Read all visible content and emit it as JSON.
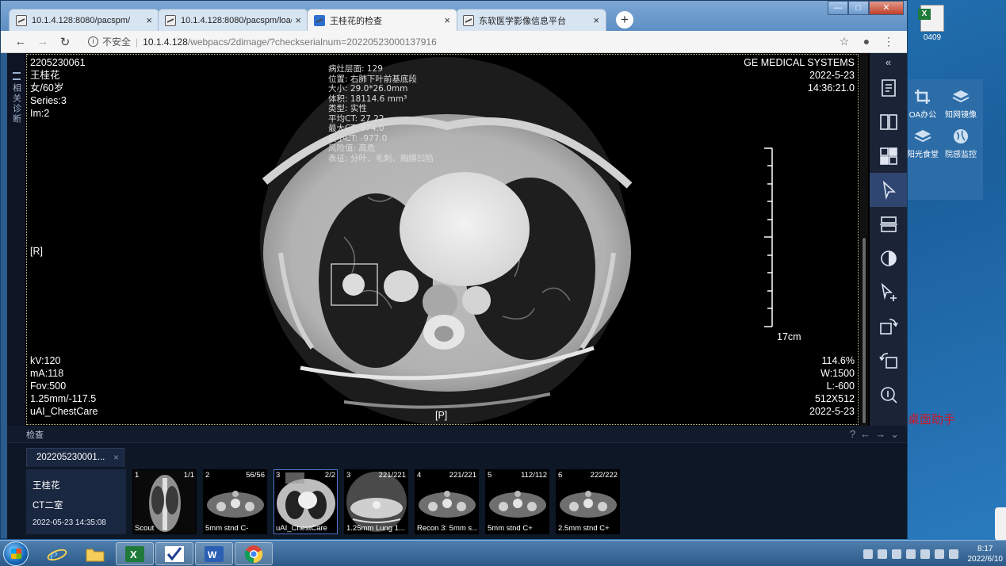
{
  "desktop": {
    "file_label": "0409",
    "icons": [
      {
        "label": "OA办公"
      },
      {
        "label": "知网镜像"
      },
      {
        "label": "阳光食堂"
      },
      {
        "label": "院感监控"
      }
    ],
    "assistant_text": "桌面助手"
  },
  "browser": {
    "tabs": [
      {
        "title": "10.1.4.128:8080/pacspm/",
        "active": false
      },
      {
        "title": "10.1.4.128:8080/pacspm/load",
        "active": false
      },
      {
        "title": "王桂花的检查",
        "active": true
      },
      {
        "title": "东软医学影像信息平台",
        "active": false
      }
    ],
    "address": {
      "security_label": "不安全",
      "host": "10.1.4.128",
      "path": "/webpacs/2dimage/?checkserialnum=20220523000137916"
    }
  },
  "viewer": {
    "left_strip_label": "相关诊断",
    "top_left": [
      "2205230061",
      "王桂花",
      "女/60岁",
      "Series:3",
      "Im:2"
    ],
    "top_right": [
      "GE MEDICAL SYSTEMS",
      "2022-5-23",
      "14:36:21.0"
    ],
    "lesion_info": [
      "病灶层面: 129",
      "位置: 右肺下叶前基底段",
      "大小: 29.0*26.0mm",
      "体积: 18114.6 mm³",
      "类型: 实性",
      "平均CT: 27.22",
      "最大CT: 874.0",
      "最小CT: -977.0",
      "风险值: 高危",
      "表征: 分叶、毛刺、胸膜凹陷"
    ],
    "bottom_left": [
      "kV:120",
      "mA:118",
      "Fov:500",
      "1.25mm/-117.5",
      "uAI_ChestCare"
    ],
    "bottom_right": [
      "114.6%",
      "W:1500",
      "L:-600",
      "512X512",
      "2022-5-23"
    ],
    "marker_right": "[R]",
    "marker_posterior": "[P]",
    "ruler_label": "17cm",
    "tools": [
      {
        "icon": "report-icon"
      },
      {
        "icon": "split-view-icon"
      },
      {
        "icon": "grid-layout-icon"
      },
      {
        "icon": "pointer-icon",
        "active": true
      },
      {
        "icon": "stack-icon"
      },
      {
        "icon": "contrast-icon"
      },
      {
        "icon": "add-pointer-icon"
      },
      {
        "icon": "rotate-right-icon"
      },
      {
        "icon": "rotate-left-icon"
      },
      {
        "icon": "zoom-fit-icon"
      }
    ]
  },
  "study_panel": {
    "section_title": "检查",
    "study_tab": "202205230001...",
    "patient_name": "王桂花",
    "room": "CT二室",
    "datetime": "2022-05-23 14:35:08",
    "series": [
      {
        "index": "1",
        "count": "1/1",
        "name": "Scout",
        "kind": "scout"
      },
      {
        "index": "2",
        "count": "56/56",
        "name": "5mm stnd C-",
        "kind": "neck"
      },
      {
        "index": "3",
        "count": "2/2",
        "name": "uAI_ChestCare",
        "kind": "chest",
        "selected": true
      },
      {
        "index": "3",
        "count": "221/221",
        "name": "1.25mm Lung 1...",
        "kind": "lung"
      },
      {
        "index": "4",
        "count": "221/221",
        "name": "Recon 3: 5mm s...",
        "kind": "neck"
      },
      {
        "index": "5",
        "count": "112/112",
        "name": "5mm stnd C+",
        "kind": "neck"
      },
      {
        "index": "6",
        "count": "222/222",
        "name": "2.5mm stnd C+",
        "kind": "neck"
      }
    ]
  },
  "taskbar": {
    "time": "8:17",
    "date": "2022/6/10"
  }
}
